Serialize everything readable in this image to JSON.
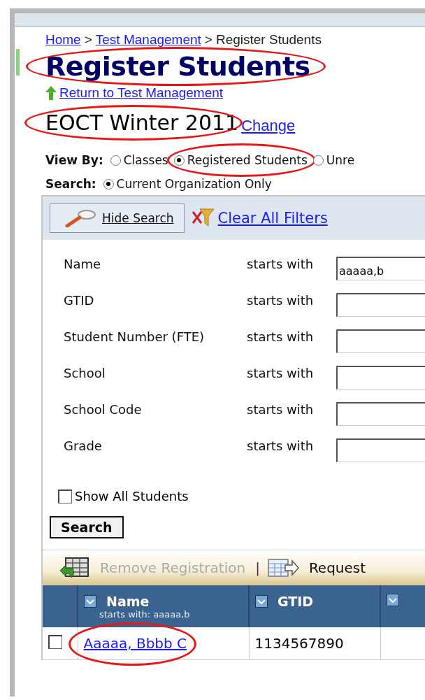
{
  "breadcrumb": [
    {
      "label": "Home",
      "link": true
    },
    {
      "separator": ">"
    },
    {
      "label": "Test Management",
      "link": true
    },
    {
      "separator": ">"
    },
    {
      "label": "Register Students",
      "link": false
    }
  ],
  "title": {
    "text": "Register Students",
    "circled": true
  },
  "return_link": "Return to Test Management",
  "test": {
    "name": "EOCT Winter 2011",
    "circled": true
  },
  "change_link": "Change",
  "view_by": {
    "label": "View By:",
    "options": [
      {
        "label": "Classes",
        "selected": false
      },
      {
        "label": "Registered Students",
        "selected": true,
        "circled": true
      },
      {
        "label": "Unre",
        "selected": false
      }
    ]
  },
  "search_scope": {
    "label": "Search:",
    "options": [
      {
        "label": "Current Organization Only",
        "selected": true
      }
    ]
  },
  "filter_panel": {
    "hide_search": "Hide Search",
    "clear_filters": "Clear All Filters",
    "filters": [
      {
        "label": "Name",
        "operator": "starts with",
        "value": "aaaaa,b"
      },
      {
        "label": "GTID",
        "operator": "starts with"
      },
      {
        "label": "Student Number (FTE)",
        "operator": "starts with"
      },
      {
        "label": "School",
        "operator": "starts with"
      },
      {
        "label": "School Code",
        "operator": "starts with"
      },
      {
        "label": "Grade",
        "operator": "starts with"
      }
    ],
    "show_all": {
      "label": "Show All Students",
      "checked": false
    },
    "search_button": "Search"
  },
  "toolbar": [
    {
      "label": "Remove Registration",
      "disabled": true,
      "kind": "remove"
    },
    {
      "separator": "|",
      "kind": "separator"
    },
    {
      "label": "Request",
      "disabled": false,
      "kind": "request"
    }
  ],
  "table": {
    "columns": [
      {
        "label": "Name",
        "filter": "starts with: aaaaa,b",
        "checked": true
      },
      {
        "label": "GTID",
        "checked": true
      },
      {
        "checked": true
      }
    ],
    "rows": [
      {
        "checked": false,
        "cells": [
          {
            "text": "Aaaaa, Bbbb C",
            "link": true,
            "circled": true
          },
          {
            "text": "1134567890",
            "link": false
          }
        ]
      }
    ]
  }
}
